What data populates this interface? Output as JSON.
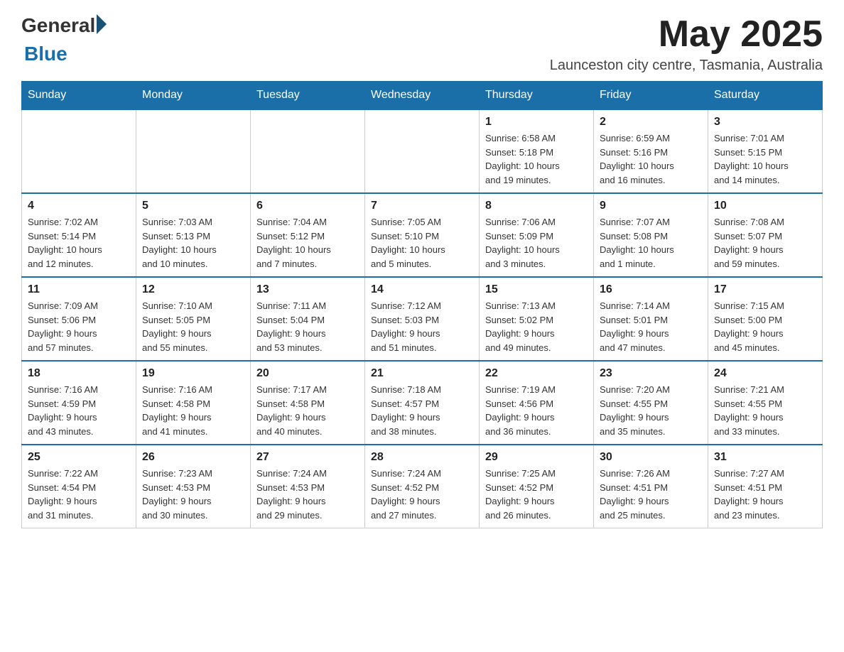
{
  "header": {
    "logo": {
      "general": "General",
      "blue": "Blue",
      "arrow": "▶"
    },
    "title": "May 2025",
    "location": "Launceston city centre, Tasmania, Australia"
  },
  "days_of_week": [
    "Sunday",
    "Monday",
    "Tuesday",
    "Wednesday",
    "Thursday",
    "Friday",
    "Saturday"
  ],
  "weeks": [
    {
      "cells": [
        {
          "day": "",
          "info": ""
        },
        {
          "day": "",
          "info": ""
        },
        {
          "day": "",
          "info": ""
        },
        {
          "day": "",
          "info": ""
        },
        {
          "day": "1",
          "info": "Sunrise: 6:58 AM\nSunset: 5:18 PM\nDaylight: 10 hours\nand 19 minutes."
        },
        {
          "day": "2",
          "info": "Sunrise: 6:59 AM\nSunset: 5:16 PM\nDaylight: 10 hours\nand 16 minutes."
        },
        {
          "day": "3",
          "info": "Sunrise: 7:01 AM\nSunset: 5:15 PM\nDaylight: 10 hours\nand 14 minutes."
        }
      ]
    },
    {
      "cells": [
        {
          "day": "4",
          "info": "Sunrise: 7:02 AM\nSunset: 5:14 PM\nDaylight: 10 hours\nand 12 minutes."
        },
        {
          "day": "5",
          "info": "Sunrise: 7:03 AM\nSunset: 5:13 PM\nDaylight: 10 hours\nand 10 minutes."
        },
        {
          "day": "6",
          "info": "Sunrise: 7:04 AM\nSunset: 5:12 PM\nDaylight: 10 hours\nand 7 minutes."
        },
        {
          "day": "7",
          "info": "Sunrise: 7:05 AM\nSunset: 5:10 PM\nDaylight: 10 hours\nand 5 minutes."
        },
        {
          "day": "8",
          "info": "Sunrise: 7:06 AM\nSunset: 5:09 PM\nDaylight: 10 hours\nand 3 minutes."
        },
        {
          "day": "9",
          "info": "Sunrise: 7:07 AM\nSunset: 5:08 PM\nDaylight: 10 hours\nand 1 minute."
        },
        {
          "day": "10",
          "info": "Sunrise: 7:08 AM\nSunset: 5:07 PM\nDaylight: 9 hours\nand 59 minutes."
        }
      ]
    },
    {
      "cells": [
        {
          "day": "11",
          "info": "Sunrise: 7:09 AM\nSunset: 5:06 PM\nDaylight: 9 hours\nand 57 minutes."
        },
        {
          "day": "12",
          "info": "Sunrise: 7:10 AM\nSunset: 5:05 PM\nDaylight: 9 hours\nand 55 minutes."
        },
        {
          "day": "13",
          "info": "Sunrise: 7:11 AM\nSunset: 5:04 PM\nDaylight: 9 hours\nand 53 minutes."
        },
        {
          "day": "14",
          "info": "Sunrise: 7:12 AM\nSunset: 5:03 PM\nDaylight: 9 hours\nand 51 minutes."
        },
        {
          "day": "15",
          "info": "Sunrise: 7:13 AM\nSunset: 5:02 PM\nDaylight: 9 hours\nand 49 minutes."
        },
        {
          "day": "16",
          "info": "Sunrise: 7:14 AM\nSunset: 5:01 PM\nDaylight: 9 hours\nand 47 minutes."
        },
        {
          "day": "17",
          "info": "Sunrise: 7:15 AM\nSunset: 5:00 PM\nDaylight: 9 hours\nand 45 minutes."
        }
      ]
    },
    {
      "cells": [
        {
          "day": "18",
          "info": "Sunrise: 7:16 AM\nSunset: 4:59 PM\nDaylight: 9 hours\nand 43 minutes."
        },
        {
          "day": "19",
          "info": "Sunrise: 7:16 AM\nSunset: 4:58 PM\nDaylight: 9 hours\nand 41 minutes."
        },
        {
          "day": "20",
          "info": "Sunrise: 7:17 AM\nSunset: 4:58 PM\nDaylight: 9 hours\nand 40 minutes."
        },
        {
          "day": "21",
          "info": "Sunrise: 7:18 AM\nSunset: 4:57 PM\nDaylight: 9 hours\nand 38 minutes."
        },
        {
          "day": "22",
          "info": "Sunrise: 7:19 AM\nSunset: 4:56 PM\nDaylight: 9 hours\nand 36 minutes."
        },
        {
          "day": "23",
          "info": "Sunrise: 7:20 AM\nSunset: 4:55 PM\nDaylight: 9 hours\nand 35 minutes."
        },
        {
          "day": "24",
          "info": "Sunrise: 7:21 AM\nSunset: 4:55 PM\nDaylight: 9 hours\nand 33 minutes."
        }
      ]
    },
    {
      "cells": [
        {
          "day": "25",
          "info": "Sunrise: 7:22 AM\nSunset: 4:54 PM\nDaylight: 9 hours\nand 31 minutes."
        },
        {
          "day": "26",
          "info": "Sunrise: 7:23 AM\nSunset: 4:53 PM\nDaylight: 9 hours\nand 30 minutes."
        },
        {
          "day": "27",
          "info": "Sunrise: 7:24 AM\nSunset: 4:53 PM\nDaylight: 9 hours\nand 29 minutes."
        },
        {
          "day": "28",
          "info": "Sunrise: 7:24 AM\nSunset: 4:52 PM\nDaylight: 9 hours\nand 27 minutes."
        },
        {
          "day": "29",
          "info": "Sunrise: 7:25 AM\nSunset: 4:52 PM\nDaylight: 9 hours\nand 26 minutes."
        },
        {
          "day": "30",
          "info": "Sunrise: 7:26 AM\nSunset: 4:51 PM\nDaylight: 9 hours\nand 25 minutes."
        },
        {
          "day": "31",
          "info": "Sunrise: 7:27 AM\nSunset: 4:51 PM\nDaylight: 9 hours\nand 23 minutes."
        }
      ]
    }
  ]
}
